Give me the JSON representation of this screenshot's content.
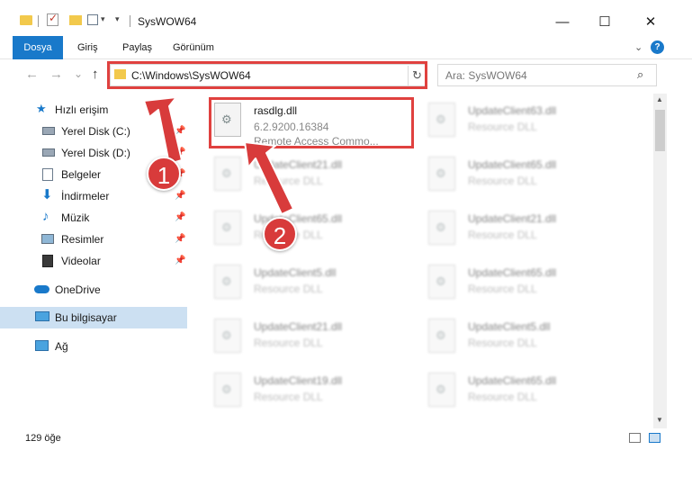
{
  "window": {
    "title": "SysWOW64",
    "minimize": "—",
    "maximize": "☐",
    "close": "✕"
  },
  "ribbon": {
    "tabs": [
      "Dosya",
      "Giriş",
      "Paylaş",
      "Görünüm"
    ],
    "help": "?"
  },
  "navigation": {
    "back": "←",
    "forward": "→",
    "recent": "⌄",
    "up": "↑"
  },
  "address": {
    "path": "C:\\Windows\\SysWOW64",
    "refresh": "↻"
  },
  "search": {
    "placeholder": "Ara: SysWOW64",
    "icon": "⌕"
  },
  "sidebar": {
    "items": [
      {
        "label": "Hızlı erişim",
        "icon": "star-icon"
      },
      {
        "label": "Yerel Disk (C:)",
        "icon": "drive-icon",
        "pinned": true
      },
      {
        "label": "Yerel Disk (D:)",
        "icon": "drive-icon",
        "pinned": true
      },
      {
        "label": "Belgeler",
        "icon": "documents-icon",
        "pinned": true
      },
      {
        "label": "İndirmeler",
        "icon": "download-icon",
        "pinned": true
      },
      {
        "label": "Müzik",
        "icon": "music-icon",
        "pinned": true
      },
      {
        "label": "Resimler",
        "icon": "pictures-icon",
        "pinned": true
      },
      {
        "label": "Videolar",
        "icon": "videos-icon",
        "pinned": true
      },
      {
        "label": "OneDrive",
        "icon": "cloud-icon"
      },
      {
        "label": "Bu bilgisayar",
        "icon": "computer-icon",
        "selected": true
      },
      {
        "label": "Ağ",
        "icon": "network-icon"
      }
    ]
  },
  "files": {
    "highlighted": {
      "name": "rasdlg.dll",
      "version": "6.2.9200.16384",
      "description": "Remote Access Commo..."
    },
    "blurred": [
      {
        "name": "UpdateClient63.dll",
        "type": "Resource DLL"
      },
      {
        "name": "UpdateClient21.dll",
        "type": "Resource DLL"
      },
      {
        "name": "UpdateClient65.dll",
        "type": "Resource DLL"
      },
      {
        "name": "UpdateClient65.dll",
        "type": "Resource DLL"
      },
      {
        "name": "UpdateClient21.dll",
        "type": "Resource DLL"
      },
      {
        "name": "UpdateClient5.dll",
        "type": "Resource DLL"
      },
      {
        "name": "UpdateClient65.dll",
        "type": "Resource DLL"
      },
      {
        "name": "UpdateClient21.dll",
        "type": "Resource DLL"
      },
      {
        "name": "UpdateClient5.dll",
        "type": "Resource DLL"
      },
      {
        "name": "UpdateClient19.dll",
        "type": "Resource DLL"
      },
      {
        "name": "UpdateClient65.dll",
        "type": "Resource DLL"
      }
    ]
  },
  "status": {
    "item_count": "129 öğe"
  },
  "annotations": {
    "step1": "1",
    "step2": "2",
    "color": "#e0413f"
  }
}
